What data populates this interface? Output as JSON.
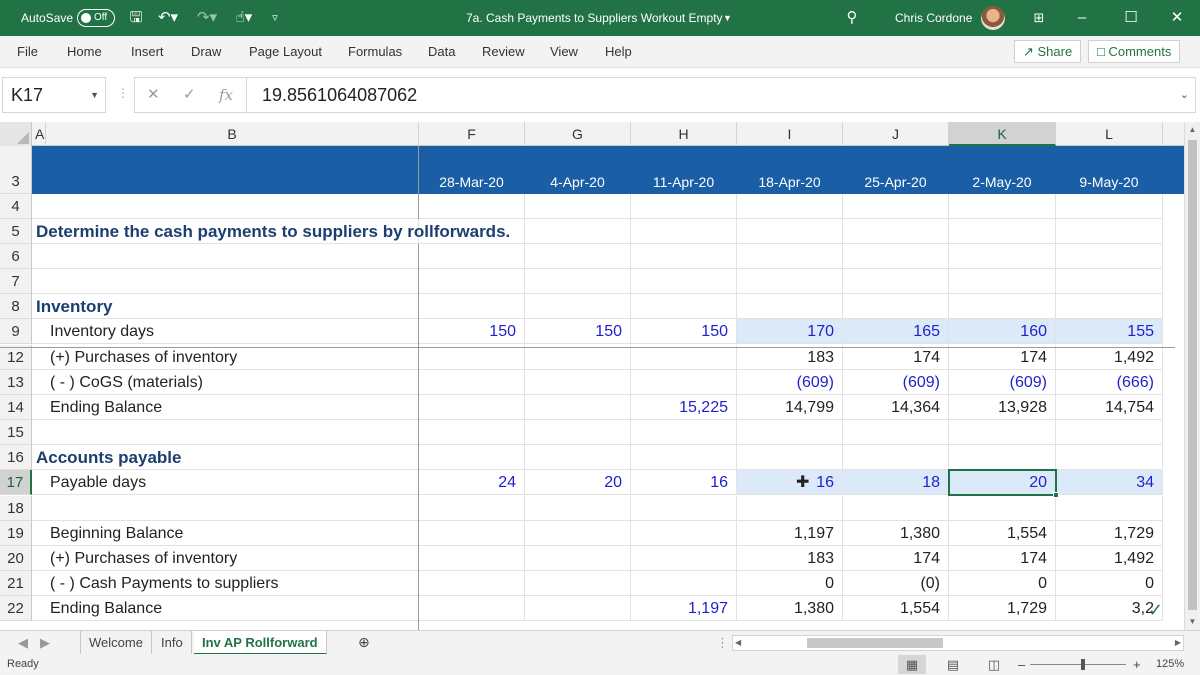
{
  "titlebar": {
    "autosave_label": "AutoSave",
    "autosave_state": "Off",
    "document_title": "7a. Cash Payments to Suppliers Workout Empty",
    "user_name": "Chris Cordone"
  },
  "ribbon": {
    "tabs": [
      "File",
      "Home",
      "Insert",
      "Draw",
      "Page Layout",
      "Formulas",
      "Data",
      "Review",
      "View",
      "Help"
    ],
    "share_label": "Share",
    "comments_label": "Comments"
  },
  "formula_bar": {
    "name_box": "K17",
    "fx": "fx",
    "value": "19.8561064087062"
  },
  "columns": [
    "A",
    "B",
    "F",
    "G",
    "H",
    "I",
    "J",
    "K",
    "L"
  ],
  "selected_column": "K",
  "rows": {
    "r3": {
      "num": "3",
      "dates": [
        "28-Mar-20",
        "4-Apr-20",
        "11-Apr-20",
        "18-Apr-20",
        "25-Apr-20",
        "2-May-20",
        "9-May-20"
      ]
    },
    "r4": {
      "num": "4"
    },
    "r5": {
      "num": "5",
      "label": "Determine the cash payments to suppliers by rollforwards."
    },
    "r6": {
      "num": "6"
    },
    "r7": {
      "num": "7"
    },
    "r8": {
      "num": "8",
      "label": "Inventory"
    },
    "r9": {
      "num": "9",
      "label": "Inventory days",
      "values": [
        "150",
        "150",
        "150",
        "170",
        "165",
        "160",
        "155"
      ]
    },
    "r12": {
      "num": "12",
      "label": "(+) Purchases of inventory",
      "values": [
        "",
        "",
        "",
        "183",
        "174",
        "174",
        "1,492"
      ]
    },
    "r13": {
      "num": "13",
      "label": "( - ) CoGS (materials)",
      "values": [
        "",
        "",
        "",
        "(609)",
        "(609)",
        "(609)",
        "(666)"
      ]
    },
    "r14": {
      "num": "14",
      "label": "Ending Balance",
      "values": [
        "",
        "",
        "15,225",
        "14,799",
        "14,364",
        "13,928",
        "14,754"
      ]
    },
    "r15": {
      "num": "15"
    },
    "r16": {
      "num": "16",
      "label": "Accounts payable"
    },
    "r17": {
      "num": "17",
      "label": "Payable days",
      "values": [
        "24",
        "20",
        "16",
        "16",
        "18",
        "20",
        "34"
      ]
    },
    "r18": {
      "num": "18"
    },
    "r19": {
      "num": "19",
      "label": "Beginning Balance",
      "values": [
        "",
        "",
        "",
        "1,197",
        "1,380",
        "1,554",
        "1,729"
      ]
    },
    "r20": {
      "num": "20",
      "label": "(+) Purchases of inventory",
      "values": [
        "",
        "",
        "",
        "183",
        "174",
        "174",
        "1,492"
      ]
    },
    "r21": {
      "num": "21",
      "label": "( - ) Cash Payments to suppliers",
      "values": [
        "",
        "",
        "",
        "0",
        "(0)",
        "0",
        "0"
      ]
    },
    "r22": {
      "num": "22",
      "label": "Ending Balance",
      "values": [
        "",
        "",
        "1,197",
        "1,380",
        "1,554",
        "1,729",
        "3,2"
      ]
    }
  },
  "sheets": {
    "tabs": [
      "Welcome",
      "Info",
      "Inv AP Rollforward"
    ],
    "active": "Inv AP Rollforward",
    "add_label": "+"
  },
  "status": {
    "ready": "Ready",
    "zoom": "125%"
  },
  "colors": {
    "excel_green": "#217346",
    "header_blue": "#1a5ea6",
    "input_blue": "#1f1fd0",
    "highlight": "#dce9f8"
  }
}
